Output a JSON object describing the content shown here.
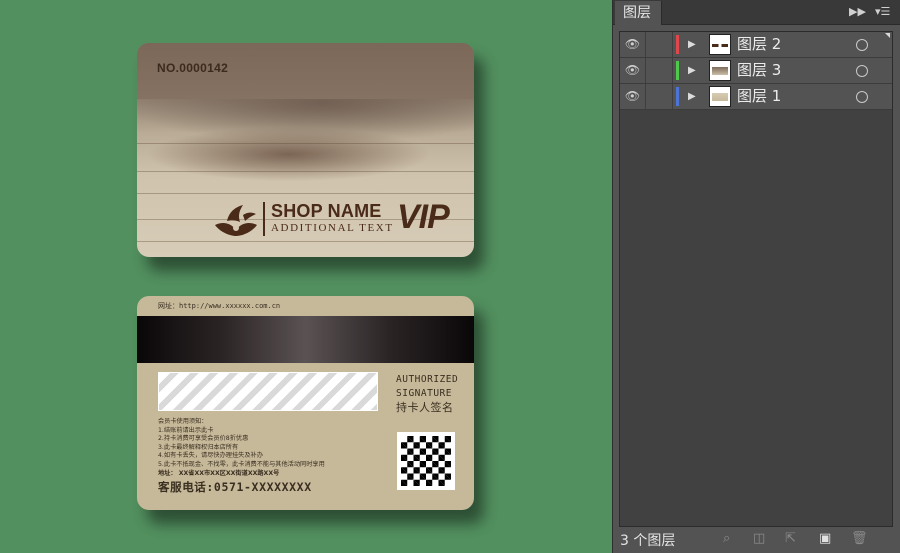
{
  "card_front": {
    "card_number": "NO.0000142",
    "shop_name": "SHOP NAME",
    "additional_text": "ADDITIONAL TEXT",
    "vip_label": "VIP",
    "brand_color": "#4a2a18"
  },
  "card_back": {
    "website": "网址：http://www.xxxxxx.com.cn",
    "authorized_line1": "AUTHORIZED",
    "authorized_line2": "SIGNATURE",
    "signature_label": "持卡人签名",
    "notice_title": "会员卡使用须知：",
    "notice_items": [
      "1.结账前请出示此卡",
      "2.持卡消费可享受会员价8折优惠",
      "3.此卡最终解释权归本店所有",
      "4.如有卡丢失，请尽快办理挂失及补办",
      "5.此卡不抵现金、不找零，此卡消费不能与其他活动同时享用"
    ],
    "address": "地址： XX省XX市XX区XX街道XX路XX号",
    "hotline": "客服电话:0571-XXXXXXXX",
    "background_color": "#c6b99a"
  },
  "layers_panel": {
    "tab_label": "图层",
    "layers": [
      {
        "name": "图层 2",
        "color": "#e0474c",
        "visible": true
      },
      {
        "name": "图层 3",
        "color": "#4fc94a",
        "visible": true
      },
      {
        "name": "图层 1",
        "color": "#4b74d6",
        "visible": true
      }
    ],
    "layer_count_text": "3 个图层",
    "icons": {
      "header": [
        "double-chevron-icon",
        "panel-menu-icon"
      ],
      "row": [
        "eye-icon",
        "expand-triangle-icon",
        "target-circle-icon"
      ],
      "footer": [
        "locate-object-icon",
        "make-clipping-mask-icon",
        "create-sublayer-icon",
        "new-layer-icon",
        "delete-icon"
      ]
    }
  }
}
